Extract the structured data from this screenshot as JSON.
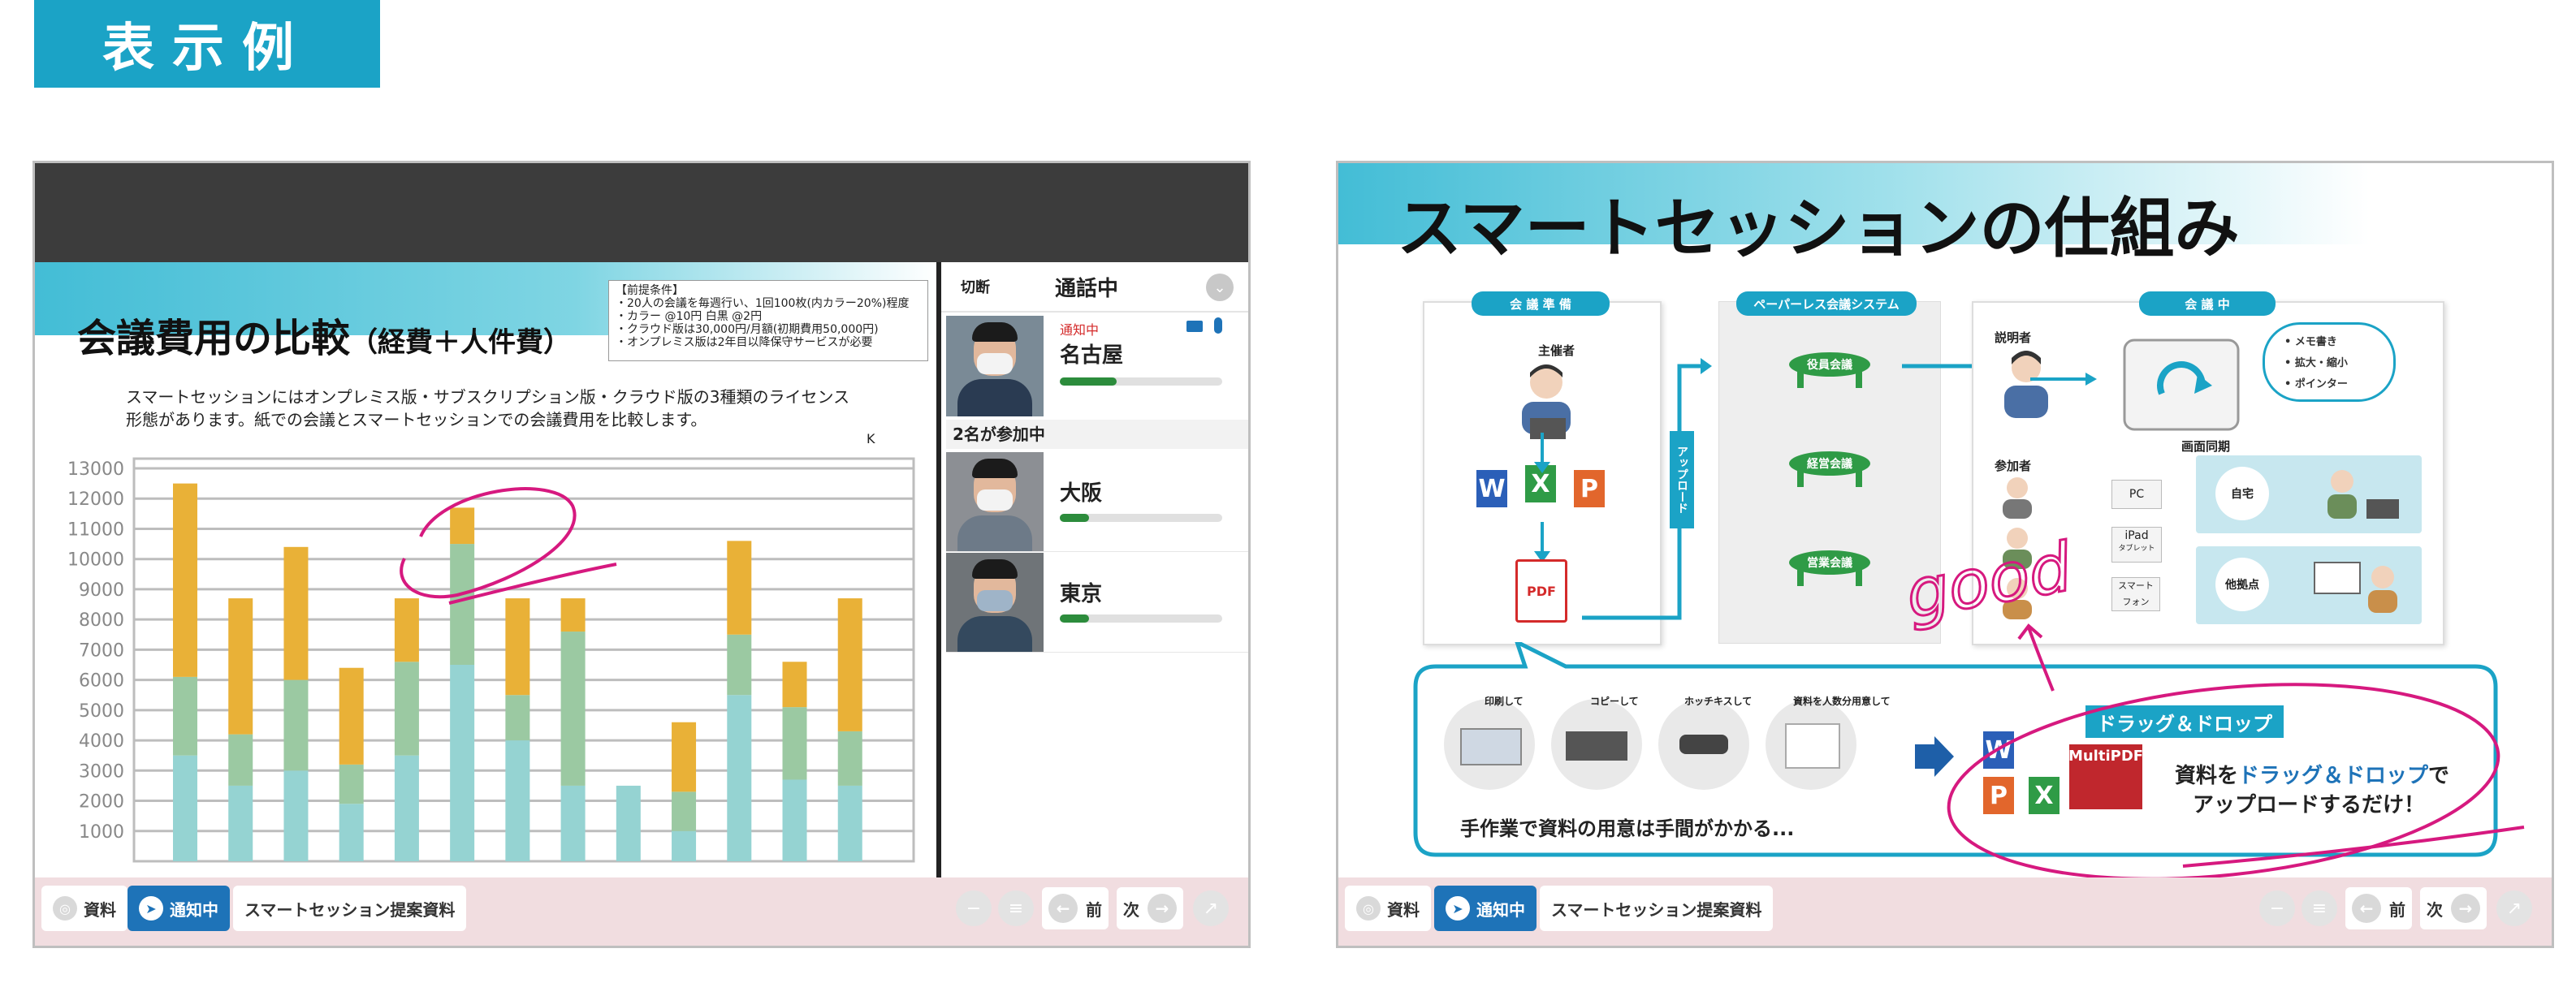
{
  "header": {
    "title": "表示例"
  },
  "left_window": {
    "slide": {
      "title": "会議費用の比較",
      "title_sub": "（経費＋人件費）",
      "premise_lines": [
        "【前提条件】",
        "・20人の会議を毎週行い、1回100枚(内カラー20%)程度",
        "・カラー @10円 白黒 @2円",
        "・クラウド版は30,000円/月額(初期費用50,000円)",
        "・オンプレミス版は2年目以降保守サービスが必要"
      ],
      "description": "スマートセッションにはオンプレミス版・サブスクリプション版・クラウド版の3種類のライセンス形態があります。紙での会議とスマートセッションでの会議費用を比較します。",
      "corner_mark": "K"
    },
    "chart_data": {
      "type": "bar",
      "stacked": true,
      "ylim": [
        0,
        13000
      ],
      "y_ticks": [
        1000,
        2000,
        3000,
        4000,
        5000,
        6000,
        7000,
        8000,
        9000,
        10000,
        11000,
        12000,
        13000
      ],
      "categories": [
        "",
        "",
        "",
        "",
        "",
        "",
        "",
        "",
        "",
        "",
        "",
        "",
        "",
        ""
      ],
      "series": [
        {
          "values": [
            3500,
            2500,
            3000,
            1900,
            3500,
            6500,
            4000,
            2500,
            2500,
            1000,
            5500,
            2700,
            2500,
            0
          ]
        },
        {
          "values": [
            2600,
            1700,
            3000,
            1300,
            3100,
            4000,
            1500,
            5100,
            0,
            1300,
            2000,
            2400,
            1800,
            0
          ]
        },
        {
          "values": [
            6400,
            4500,
            4400,
            3200,
            2100,
            1200,
            3200,
            1100,
            0,
            2300,
            3100,
            1500,
            4400,
            0
          ]
        }
      ],
      "colors": [
        "#95d3d2",
        "#9bc9a2",
        "#e9b137"
      ]
    },
    "call": {
      "disconnect_label": "切断",
      "status_label": "通話中",
      "notify_label": "通知中",
      "participants_count_label": "2名が参加中",
      "participants": [
        {
          "location": "名古屋",
          "level": 0.35
        },
        {
          "location": "大阪",
          "level": 0.18
        },
        {
          "location": "東京",
          "level": 0.18
        }
      ]
    },
    "toolbar": {
      "materials_label": "資料",
      "notify_label": "通知中",
      "doc_title": "スマートセッション提案資料",
      "prev_label": "前",
      "next_label": "次"
    }
  },
  "right_window": {
    "slide": {
      "title": "スマートセッションの仕組み",
      "prep_pill": "会 議 準 備",
      "prep_host": "主催者",
      "pdf_label": "PDF",
      "paperless_pill": "ペーパーレス会議システム",
      "upload_label": "アップロード",
      "meetings": [
        "役員会議",
        "経営会議",
        "営業会議"
      ],
      "meeting_pill": "会 議 中",
      "presenter_label": "説明者",
      "features": [
        "メモ書き",
        "拡大・縮小",
        "ポインター"
      ],
      "sync_label": "画面同期",
      "attendees_label": "参加者",
      "devices": [
        "PC",
        "iPad",
        "スマートフォン"
      ],
      "device_sub": "タブレット",
      "places": [
        "自宅",
        "他拠点"
      ],
      "handwriting": "good",
      "manual_captions": [
        "印刷して",
        "コピーして",
        "ホッチキスして",
        "資料を人数分用意して"
      ],
      "manual_text": "手作業で資料の用意は手間がかかる...",
      "dnd_badge": "ドラッグ＆ドロップ",
      "multipdf_label": "MultiPDF",
      "dnd_text_1": "資料を",
      "dnd_text_highlight": "ドラッグ＆ドロップ",
      "dnd_text_2": "で",
      "dnd_text_3": "アップロードするだけ！"
    },
    "toolbar": {
      "materials_label": "資料",
      "notify_label": "通知中",
      "doc_title": "スマートセッション提案資料",
      "prev_label": "前",
      "next_label": "次"
    }
  },
  "colors": {
    "accent": "#1ba3c6",
    "ink": "#d6197f",
    "toolbar_bg": "#f1dde0",
    "notify_btn": "#1e73b8"
  }
}
